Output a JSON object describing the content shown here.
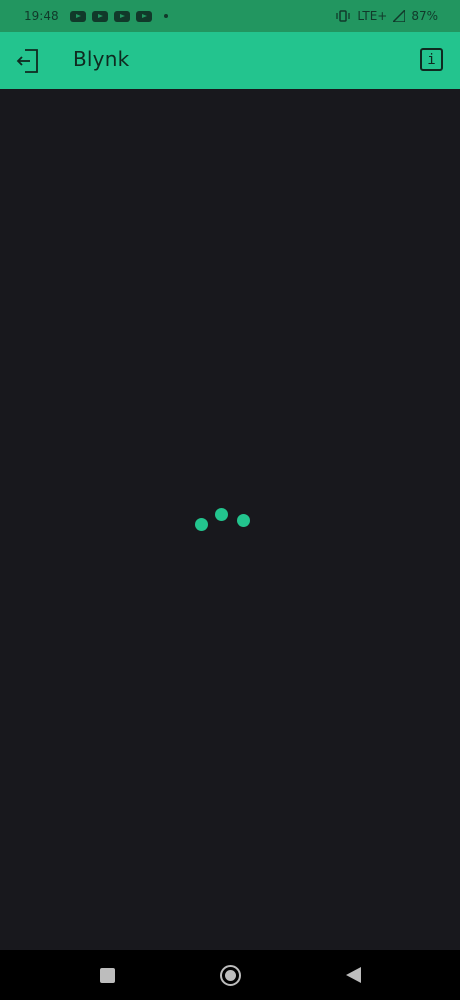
{
  "status_bar": {
    "time": "19:48",
    "notification_icons": [
      "youtube-icon",
      "youtube-icon",
      "youtube-icon",
      "youtube-icon"
    ],
    "network": "LTE+",
    "battery": "87%"
  },
  "app_bar": {
    "title": "Blynk",
    "info_label": "i",
    "background": "#23c48e"
  },
  "loader": {
    "color": "#23c48e"
  },
  "nav_bar": {
    "buttons": [
      "recents",
      "home",
      "back"
    ]
  }
}
